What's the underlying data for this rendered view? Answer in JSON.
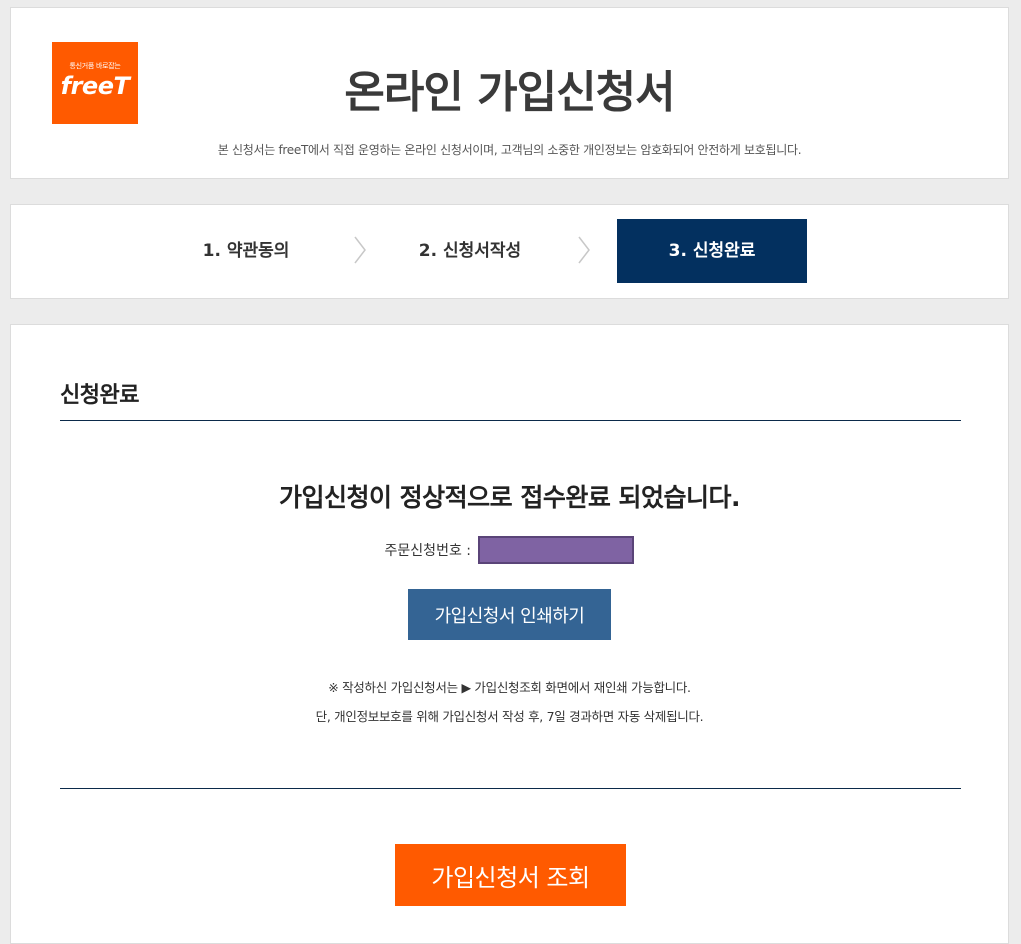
{
  "header": {
    "logo_tagline": "통신거품 바로잡는",
    "logo_brand": "freeT",
    "title": "온라인 가입신청서",
    "subtitle": "본 신청서는 freeT에서 직접 운영하는 온라인 신청서이며, 고객님의 소중한 개인정보는 암호화되어 안전하게 보호됩니다."
  },
  "steps": [
    {
      "label": "1. 약관동의",
      "active": false
    },
    {
      "label": "2. 신청서작성",
      "active": false
    },
    {
      "label": "3. 신청완료",
      "active": true
    }
  ],
  "main": {
    "section_title": "신청완료",
    "done_message": "가입신청이 정상적으로 접수완료 되었습니다.",
    "order_label": "주문신청번호 :",
    "print_button": "가입신청서 인쇄하기",
    "note_1": "※ 작성하신 가입신청서는 ▶ 가입신청조회 화면에서 재인쇄 가능합니다.",
    "note_2": "단, 개인정보보호를 위해 가입신청서 작성 후, 7일 경과하면 자동 삭제됩니다.",
    "lookup_button": "가입신청서 조회"
  },
  "colors": {
    "brand_orange": "#ff5a00",
    "active_step_navy": "#03305f",
    "print_button_blue": "#346494",
    "redaction_purple": "#7f63a3"
  }
}
